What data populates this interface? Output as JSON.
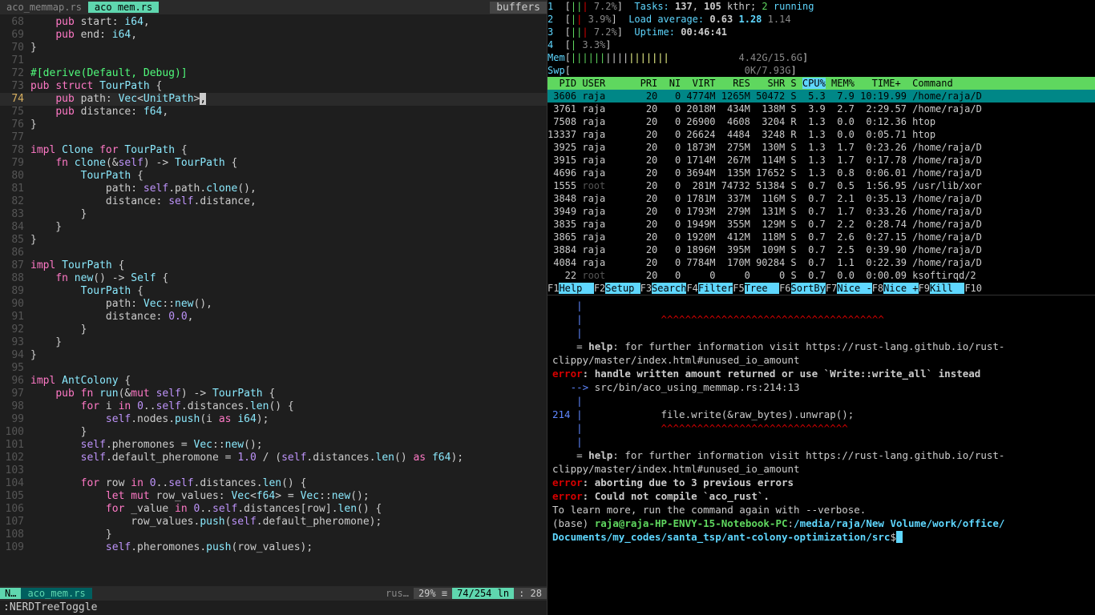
{
  "editor": {
    "tabs": [
      {
        "name": "aco_memmap.rs",
        "active": false
      },
      {
        "name": " aco mem.rs ",
        "active": true
      }
    ],
    "buffers_label": "buffers",
    "lines": [
      {
        "n": "68",
        "html": "    <span class='kw'>pub</span> start: <span class='ty'>i64</span>,"
      },
      {
        "n": "69",
        "html": "    <span class='kw'>pub</span> end: <span class='ty'>i64</span>,"
      },
      {
        "n": "70",
        "html": "}"
      },
      {
        "n": "71",
        "html": ""
      },
      {
        "n": "72",
        "html": "<span class='attr'>#[derive(Default, Debug)]</span>"
      },
      {
        "n": "73",
        "html": "<span class='kw'>pub</span> <span class='kw'>struct</span> <span class='ty'>TourPath</span> {"
      },
      {
        "n": "74",
        "html": "    <span class='kw'>pub</span> path: <span class='ty'>Vec</span>&lt;<span class='ty'>UnitPath</span>&gt;<span class='cursor'>,</span>",
        "current": true
      },
      {
        "n": "75",
        "html": "    <span class='kw'>pub</span> distance: <span class='ty'>f64</span>,"
      },
      {
        "n": "76",
        "html": "}"
      },
      {
        "n": "77",
        "html": ""
      },
      {
        "n": "78",
        "html": "<span class='kw'>impl</span> <span class='ty'>Clone</span> <span class='kw'>for</span> <span class='ty'>TourPath</span> {"
      },
      {
        "n": "79",
        "html": "    <span class='kw'>fn</span> <span class='fn'>clone</span>(&amp;<span class='self'>self</span>) -&gt; <span class='ty'>TourPath</span> {"
      },
      {
        "n": "80",
        "html": "        <span class='ty'>TourPath</span> {"
      },
      {
        "n": "81",
        "html": "            path: <span class='self'>self</span>.path.<span class='fn'>clone</span>(),"
      },
      {
        "n": "82",
        "html": "            distance: <span class='self'>self</span>.distance,"
      },
      {
        "n": "83",
        "html": "        }"
      },
      {
        "n": "84",
        "html": "    }"
      },
      {
        "n": "85",
        "html": "}"
      },
      {
        "n": "86",
        "html": ""
      },
      {
        "n": "87",
        "html": "<span class='kw'>impl</span> <span class='ty'>TourPath</span> {"
      },
      {
        "n": "88",
        "html": "    <span class='kw'>fn</span> <span class='fn'>new</span>() -&gt; <span class='ty'>Self</span> {"
      },
      {
        "n": "89",
        "html": "        <span class='ty'>TourPath</span> {"
      },
      {
        "n": "90",
        "html": "            path: <span class='ty'>Vec</span>::<span class='fn'>new</span>(),"
      },
      {
        "n": "91",
        "html": "            distance: <span class='num'>0.0</span>,"
      },
      {
        "n": "92",
        "html": "        }"
      },
      {
        "n": "93",
        "html": "    }"
      },
      {
        "n": "94",
        "html": "}"
      },
      {
        "n": "95",
        "html": ""
      },
      {
        "n": "96",
        "html": "<span class='kw'>impl</span> <span class='ty'>AntColony</span> {"
      },
      {
        "n": "97",
        "html": "    <span class='kw'>pub</span> <span class='kw'>fn</span> <span class='fn'>run</span>(&amp;<span class='kw'>mut</span> <span class='self'>self</span>) -&gt; <span class='ty'>TourPath</span> {"
      },
      {
        "n": "98",
        "html": "        <span class='kw'>for</span> i <span class='kw'>in</span> <span class='num'>0</span>..<span class='self'>self</span>.distances.<span class='fn'>len</span>() {"
      },
      {
        "n": "99",
        "html": "            <span class='self'>self</span>.nodes.<span class='fn'>push</span>(i <span class='kw'>as</span> <span class='ty'>i64</span>);"
      },
      {
        "n": "100",
        "html": "        }"
      },
      {
        "n": "101",
        "html": "        <span class='self'>self</span>.pheromones = <span class='ty'>Vec</span>::<span class='fn'>new</span>();"
      },
      {
        "n": "102",
        "html": "        <span class='self'>self</span>.default_pheromone = <span class='num'>1.0</span> / (<span class='self'>self</span>.distances.<span class='fn'>len</span>() <span class='kw'>as</span> <span class='ty'>f64</span>);"
      },
      {
        "n": "103",
        "html": ""
      },
      {
        "n": "104",
        "html": "        <span class='kw'>for</span> row <span class='kw'>in</span> <span class='num'>0</span>..<span class='self'>self</span>.distances.<span class='fn'>len</span>() {"
      },
      {
        "n": "105",
        "html": "            <span class='kw'>let</span> <span class='kw'>mut</span> row_values: <span class='ty'>Vec</span>&lt;<span class='ty'>f64</span>&gt; = <span class='ty'>Vec</span>::<span class='fn'>new</span>();"
      },
      {
        "n": "106",
        "html": "            <span class='kw'>for</span> _value <span class='kw'>in</span> <span class='num'>0</span>..<span class='self'>self</span>.distances[row].<span class='fn'>len</span>() {"
      },
      {
        "n": "107",
        "html": "                row_values.<span class='fn'>push</span>(<span class='self'>self</span>.default_pheromone);"
      },
      {
        "n": "108",
        "html": "            }"
      },
      {
        "n": "109",
        "html": "            <span class='self'>self</span>.pheromones.<span class='fn'>push</span>(row_values);"
      }
    ],
    "status": {
      "mode": "N…",
      "file": "aco_mem.rs",
      "lang": "rus…",
      "pct": "29% ≡",
      "pos": "74/254 ln",
      "col": ": 28"
    },
    "cmdline": ":NERDTreeToggle"
  },
  "htop": {
    "cpus": [
      {
        "id": "1",
        "bar": "||<span class='r'>|</span>",
        "pct": "7.2%"
      },
      {
        "id": "2",
        "bar": "|<span class='r'>|</span>",
        "pct": "3.9%"
      },
      {
        "id": "3",
        "bar": "||<span class='r'>|</span>",
        "pct": "7.2%"
      },
      {
        "id": "4",
        "bar": "|",
        "pct": "3.3%"
      }
    ],
    "mem": {
      "label": "Mem",
      "bar": "<span class='cpu-bar'>||||||</span><span class='b'>||||</span><span class='str'>|||||||</span>",
      "val": "4.42G/15.6G"
    },
    "swp": {
      "label": "Swp",
      "bar": "",
      "val": "0K/7.93G"
    },
    "tasks": {
      "label": "Tasks:",
      "total": "137",
      "kthr": "105",
      "kthr_lbl": "kthr;",
      "run": "2",
      "run_lbl": "running"
    },
    "load": {
      "label": "Load average:",
      "a": "0.63",
      "b": "1.28",
      "c": "1.14"
    },
    "uptime": {
      "label": "Uptime:",
      "val": "00:46:41"
    },
    "header": "  PID USER      PRI  NI  VIRT   RES   SHR S CPU% MEM%   TIME+  Command",
    "procs": [
      {
        "sel": true,
        "t": " 3606 raja       20   0 4774M 1265M 50472 S  5.3  7.9 10:19.99 /home/raja/D"
      },
      {
        "sel": false,
        "t": " 3761 raja       20   0 2018M  434M  138M S  3.9  2.7  2:29.57 /home/raja/D"
      },
      {
        "sel": false,
        "t": " 7508 raja       20   0 26900  4608  3204 R  1.3  0.0  0:12.36 htop"
      },
      {
        "sel": false,
        "t": "13337 raja       20   0 26624  4484  3248 R  1.3  0.0  0:05.71 htop"
      },
      {
        "sel": false,
        "t": " 3925 raja       20   0 1873M  275M  130M S  1.3  1.7  0:23.26 /home/raja/D"
      },
      {
        "sel": false,
        "t": " 3915 raja       20   0 1714M  267M  114M S  1.3  1.7  0:17.78 /home/raja/D"
      },
      {
        "sel": false,
        "t": " 4696 raja       20   0 3694M  135M 17652 S  1.3  0.8  0:06.01 /home/raja/D"
      },
      {
        "sel": false,
        "t": " 1555 root       20   0  281M 74732 51384 S  0.7  0.5  1:56.95 /usr/lib/xor",
        "root": true
      },
      {
        "sel": false,
        "t": " 3848 raja       20   0 1781M  337M  116M S  0.7  2.1  0:35.13 /home/raja/D"
      },
      {
        "sel": false,
        "t": " 3949 raja       20   0 1793M  279M  131M S  0.7  1.7  0:33.26 /home/raja/D"
      },
      {
        "sel": false,
        "t": " 3835 raja       20   0 1949M  355M  129M S  0.7  2.2  0:28.74 /home/raja/D"
      },
      {
        "sel": false,
        "t": " 3865 raja       20   0 1920M  412M  118M S  0.7  2.6  0:27.15 /home/raja/D"
      },
      {
        "sel": false,
        "t": " 3884 raja       20   0 1896M  395M  109M S  0.7  2.5  0:39.90 /home/raja/D"
      },
      {
        "sel": false,
        "t": " 4084 raja       20   0 7784M  170M 90284 S  0.7  1.1  0:22.39 /home/raja/D"
      },
      {
        "sel": false,
        "t": "   22 root       20   0     0     0     0 S  0.7  0.0  0:00.09 ksoftirqd/2",
        "root": true
      }
    ],
    "fkeys": [
      {
        "k": "F1",
        "v": "Help  "
      },
      {
        "k": "F2",
        "v": "Setup "
      },
      {
        "k": "F3",
        "v": "Search"
      },
      {
        "k": "F4",
        "v": "Filter"
      },
      {
        "k": "F5",
        "v": "Tree  "
      },
      {
        "k": "F6",
        "v": "SortBy"
      },
      {
        "k": "F7",
        "v": "Nice -"
      },
      {
        "k": "F8",
        "v": "Nice +"
      },
      {
        "k": "F9",
        "v": "Kill  "
      },
      {
        "k": "F10",
        "v": ""
      }
    ]
  },
  "term": {
    "lines": [
      "    <span class='blue'>|</span>",
      "    <span class='blue'>|</span>             <span class='squig'>^^^^^^^^^^^^^^^^^^^^^^^^^^^^^^^^^^^^^</span>",
      "    <span class='blue'>|</span>",
      "    = <span class='help'>help</span>: for further information visit https://rust-lang.github.io/rust-clippy/master/index.html#unused_io_amount",
      "",
      "<span class='err'>error</span><span class='help'>: handle written amount returned or use `Write::write_all` instead</span>",
      "   <span class='blue'>--&gt;</span> src/bin/aco_using_memmap.rs:214:13",
      "    <span class='blue'>|</span>",
      "<span class='blue'>214</span> <span class='blue'>|</span>             file.write(&amp;raw_bytes).unwrap();",
      "    <span class='blue'>|</span>             <span class='squig'>^^^^^^^^^^^^^^^^^^^^^^^^^^^^^^^</span>",
      "    <span class='blue'>|</span>",
      "    = <span class='help'>help</span>: for further information visit https://rust-lang.github.io/rust-clippy/master/index.html#unused_io_amount",
      "",
      "<span class='err'>error</span><span class='help'>: aborting due to 3 previous errors</span>",
      "",
      "<span class='err'>error</span><span class='help'>: Could not compile `aco_rust`.</span>",
      "",
      "To learn more, run the command again with --verbose.",
      "(base) <span class='grn'>raja@raja-HP-ENVY-15-Notebook-PC</span>:<span class='cyan'>/media/raja/New Volume/work/office/</span>",
      "<span class='cyan'>Documents/my_codes/santa_tsp/ant-colony-optimization/src</span>$<span class='tcursor'> </span>"
    ]
  }
}
